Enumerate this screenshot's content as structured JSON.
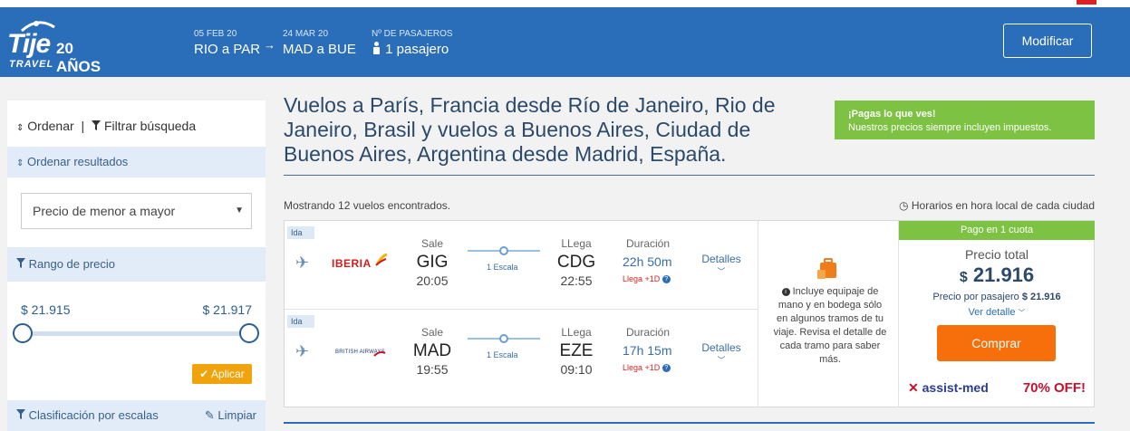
{
  "header": {
    "brand": "Tije",
    "years": "20 AÑOS",
    "tagline": "TRAVEL",
    "segments": [
      {
        "date": "05 FEB 20",
        "route": "RIO a PAR"
      },
      {
        "date": "24 MAR 20",
        "route": "MAD a BUE"
      }
    ],
    "arrow": "→",
    "passengers_label": "Nº DE PASAJEROS",
    "passengers_value": "1 pasajero",
    "modify_button": "Modificar"
  },
  "sidebar": {
    "sort_label": "Ordenar",
    "divider": "|",
    "filter_label": "Filtrar búsqueda",
    "order_results_label": "Ordenar resultados",
    "order_select_value": "Precio de menor a mayor",
    "price_range_label": "Rango de precio",
    "price_min": "$ 21.915",
    "price_max": "$ 21.917",
    "apply_button": "Aplicar",
    "stops_label": "Clasificación por escalas",
    "clear_label": "Limpiar"
  },
  "main": {
    "title": "Vuelos a París, Francia desde Río de Janeiro, Rio de Janeiro, Brasil y vuelos a Buenos Aires, Ciudad de Buenos Aires, Argentina desde Madrid, España.",
    "promo_line1": "¡Pagas lo que ves!",
    "promo_line2": "Nuestros precios siempre incluyen impuestos.",
    "results_count": "Mostrando 12 vuelos encontrados.",
    "local_time_note": "Horarios en hora local de cada ciudad"
  },
  "flight_card": {
    "legs": [
      {
        "tag": "Ida",
        "airline": "IBERIA",
        "depart_label": "Sale",
        "depart_code": "GIG",
        "depart_time": "20:05",
        "stops": "1 Escala",
        "arrive_label": "LLega",
        "arrive_code": "CDG",
        "arrive_time": "22:55",
        "duration_label": "Duración",
        "duration": "22h 50m",
        "arrival_note": "Llega +1D",
        "details": "Detalles"
      },
      {
        "tag": "Ida",
        "airline": "BRITISH AIRWAYS",
        "depart_label": "Sale",
        "depart_code": "MAD",
        "depart_time": "19:55",
        "stops": "1 Escala",
        "arrive_label": "LLega",
        "arrive_code": "EZE",
        "arrive_time": "09:10",
        "duration_label": "Duración",
        "duration": "17h 15m",
        "arrival_note": "Llega +1D",
        "details": "Detalles"
      }
    ],
    "baggage_note": "Incluye equipaje de mano y en bodega sólo en algunos tramos de tu viaje. Revisa el detalle de cada tramo para saber más.",
    "payment_banner": "Pago en 1 cuota",
    "total_label": "Precio total",
    "currency": "$",
    "total_amount": "21.916",
    "per_passenger_label": "Precio por pasajero",
    "per_passenger_amount": "$ 21.916",
    "see_detail": "Ver detalle",
    "buy_button": "Comprar",
    "insurance_brand": "assist-med",
    "insurance_offer": "70% OFF!"
  },
  "colors": {
    "header_blue": "#2a6db8",
    "promo_green": "#7dc242",
    "buy_orange": "#f76f0a",
    "apply_yellow": "#f0a30a"
  },
  "icons": {
    "sort": "sort-icon",
    "filter": "filter-icon",
    "plane": "plane-icon",
    "luggage": "luggage-icon",
    "clock": "clock-icon",
    "person": "person-icon"
  },
  "price_range_selection": {
    "min_fraction": 0.0,
    "max_fraction": 1.0
  }
}
